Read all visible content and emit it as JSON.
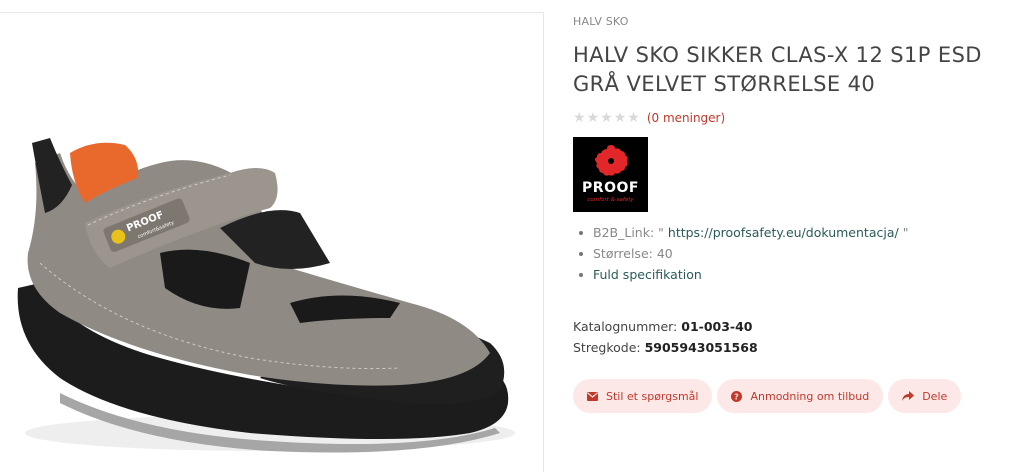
{
  "product": {
    "category": "HALV SKO",
    "title": "HALV SKO SIKKER CLAS-X 12 S1P ESD GRÅ VELVET STØRRELSE 40",
    "opinions": "(0 meninger)",
    "rating": 0,
    "stars_max": 5
  },
  "brand": {
    "name": "PROOF",
    "tagline": "comfort & safety",
    "shoe_label": "PROOF",
    "shoe_sub": "comfort&safety"
  },
  "attributes": {
    "b2b_key": "B2B_Link: \"",
    "b2b_url": "https://proofsafety.eu/dokumentacja/",
    "b2b_end": "\"",
    "size_label": "Størrelse: 40",
    "spec_link": "Fuld specifikation"
  },
  "meta": {
    "catalog_label": "Katalognummer: ",
    "catalog_value": "01-003-40",
    "barcode_label": "Stregkode: ",
    "barcode_value": "5905943051568"
  },
  "actions": {
    "ask": "Stil et spørgsmål",
    "quote": "Anmodning om tilbud",
    "share": "Dele"
  },
  "colors": {
    "accent": "#c0392b",
    "button_bg": "#fde8e8",
    "brand_red": "#e2262a"
  }
}
